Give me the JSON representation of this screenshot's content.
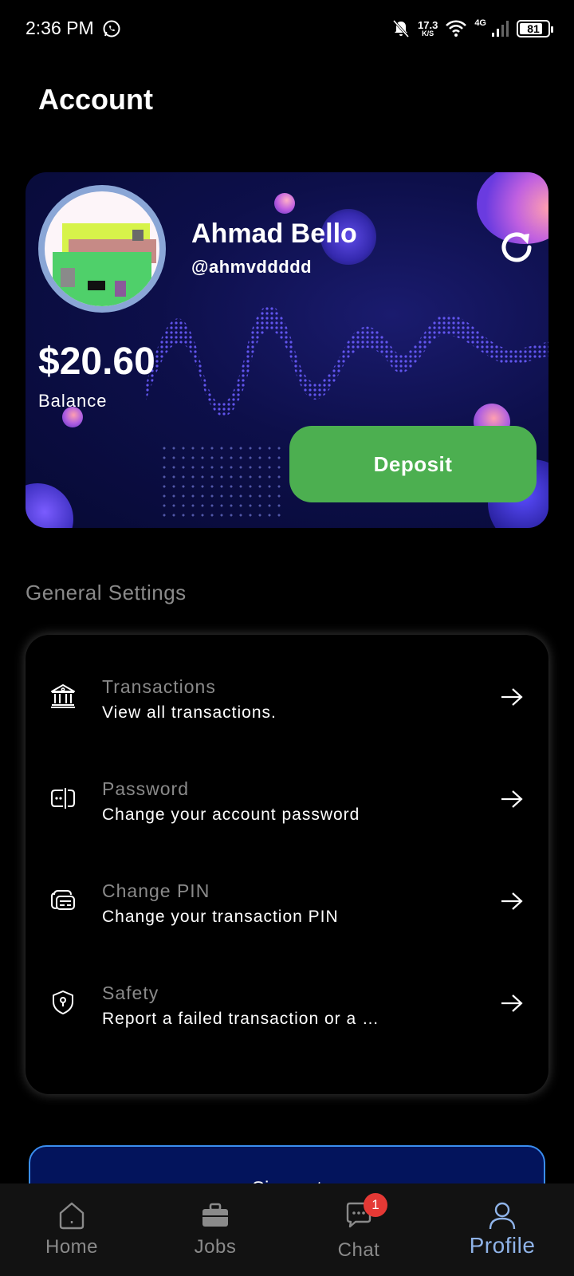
{
  "status_bar": {
    "time": "2:36 PM",
    "net_speed_value": "17.3",
    "net_speed_unit": "K/S",
    "network_type": "4G",
    "battery": "81",
    "battery_level": 0.81,
    "icons": [
      "whatsapp-icon",
      "bell-off-icon",
      "wifi-icon",
      "signal-icon",
      "battery-icon"
    ]
  },
  "page": {
    "title": "Account"
  },
  "account_card": {
    "name": "Ahmad Bello",
    "handle": "@ahmvddddd",
    "balance": "$20.60",
    "balance_label": "Balance",
    "deposit_label": "Deposit",
    "refresh_icon": "refresh-icon"
  },
  "settings": {
    "section_title": "General Settings",
    "items": [
      {
        "title": "Transactions",
        "description": "View all transactions.",
        "icon": "bank-icon"
      },
      {
        "title": "Password",
        "description": "Change your account password",
        "icon": "password-icon"
      },
      {
        "title": "Change PIN",
        "description": "Change your transaction PIN",
        "icon": "card-pin-icon"
      },
      {
        "title": "Safety",
        "description": "Report a failed transaction or a …",
        "icon": "shield-icon"
      }
    ]
  },
  "signout": {
    "label": "Sign out"
  },
  "bottom_nav": {
    "items": [
      {
        "label": "Home",
        "icon": "home-icon"
      },
      {
        "label": "Jobs",
        "icon": "briefcase-icon"
      },
      {
        "label": "Chat",
        "icon": "chat-icon",
        "badge": "1"
      },
      {
        "label": "Profile",
        "icon": "profile-icon",
        "active": true
      }
    ]
  },
  "colors": {
    "background": "#000000",
    "card_gradient": "#0d0f4a",
    "deposit_green": "#4caf50",
    "active_nav": "#8fb3e8",
    "badge_red": "#e53935"
  }
}
